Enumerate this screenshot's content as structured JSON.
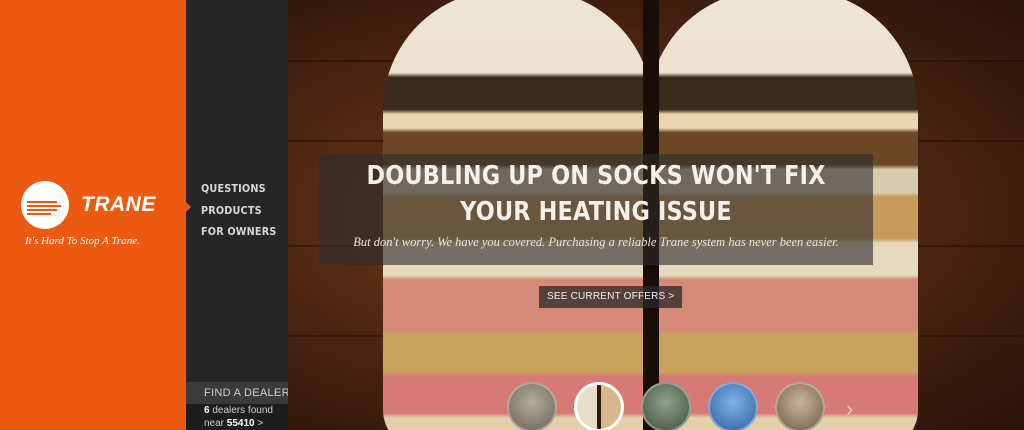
{
  "brand": {
    "name": "TRANE",
    "tagline": "It's Hard To Stop A Trane.",
    "color": "#ec5a12"
  },
  "nav": {
    "items": [
      "QUESTIONS",
      "PRODUCTS",
      "FOR OWNERS"
    ],
    "pointer_icon": "triangle-right-icon"
  },
  "dealer": {
    "heading": "FIND A DEALER",
    "count": "6",
    "count_suffix": "dealers found",
    "near_label": "near",
    "zip": "55410",
    "arrow": ">"
  },
  "hero": {
    "headline_line1": "DOUBLING UP ON SOCKS WON'T FIX",
    "headline_line2": "YOUR HEATING ISSUE",
    "subtext": "But don't worry. We have you covered. Purchasing a reliable Trane system has never been easier.",
    "cta": "SEE CURRENT OFFERS >"
  },
  "carousel": {
    "active_index": 1,
    "thumbnails": [
      "thumb-people",
      "thumb-socks",
      "thumb-family",
      "thumb-sky",
      "thumb-outdoors"
    ],
    "next_arrow": "›"
  }
}
